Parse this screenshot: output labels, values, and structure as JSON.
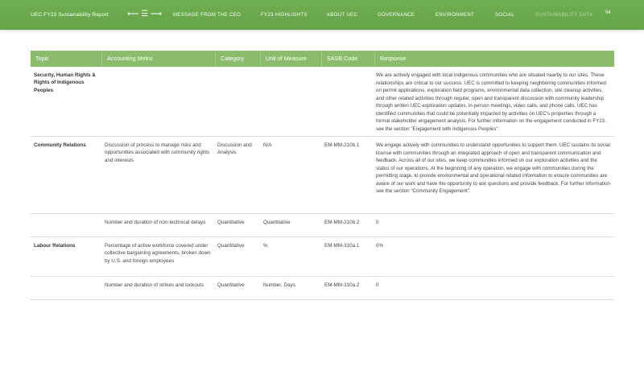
{
  "header": {
    "report_title": "UEC FY23 Sustainability Report",
    "nav_arrows": "⟵ ☰ ⟶",
    "nav": [
      {
        "label": "MESSAGE FROM THE CEO"
      },
      {
        "label": "FY23 HIGHLIGHTS"
      },
      {
        "label": "ABOUT UEC"
      },
      {
        "label": "GOVERNANCE"
      },
      {
        "label": "ENVIRONMENT"
      },
      {
        "label": "SOCIAL"
      },
      {
        "label": "SUSTAINABILITY DATA"
      }
    ],
    "page_number": "94",
    "bar_color": "#6aa84f"
  },
  "table": {
    "header_color": "#8bbc6b",
    "columns": [
      "Topic",
      "Accounting Metric",
      "Category",
      "Unit of Measure",
      "SASB Code",
      "Response"
    ],
    "rows": [
      {
        "topic": "Security, Human Rights & Rights of Indigenous Peoples",
        "metric": "",
        "category": "",
        "unit": "",
        "code": "",
        "response": "We are actively engaged with local indigenous communities who are situated nearby to our sites. These relationships are critical to our success. UEC is committed to keeping neighboring communities informed on permit applications, exploration field programs, environmental data collection, site cleanup activities, and other related activities through regular, open and transparent discussion with community leadership through written UEC exploration updates, in-person meetings, video calls, and phone calls. UEC has identified communities that could be potentially impacted by activities on UEC's properties through a formal stakeholder engagement analysis. For further information on the engagement conducted in FY23, see the section \"Engagement with Indigenous Peoples\"."
      },
      {
        "topic": "Community Relations",
        "metric": "Discussion of process to manage risks and opportunities associated with community rights and interests",
        "category": "Discussion and Analysis",
        "unit": "N/A",
        "code": "EM-MM-210b.1",
        "response": "We engage actively with communities to understand opportunities to support them. UEC sustains its social license with communities through an integrated approach of open and transparent communication and feedback. Across all of our sites, we keep communities informed on our exploration activities and the status of our operations. At the beginning of any operation, we engage with communities during the permitting stage, to provide environmental and operational related information to ensure communities are aware of our work and have the opportunity to ask questions and provide feedback. For further information see the section \"Community Engagement\"."
      },
      {
        "topic": "",
        "metric": "Number and duration of non-technical delays",
        "category": "Quantitative",
        "unit": "Quantitative",
        "code": "EM-MM-210b.2",
        "response": "0"
      },
      {
        "topic": "Labour Relations",
        "metric": "Percentage of active workforce covered under collective bargaining agreements, broken down by U.S. and foreign employees",
        "category": "Quantitative",
        "unit": "%",
        "code": "EM-MM-310a.1",
        "response": "0%"
      },
      {
        "topic": "",
        "metric": "Number and duration of strikes and lockouts",
        "category": "Quantitative",
        "unit": "Number, Days",
        "code": "EM-MM-310a.2",
        "response": "0"
      }
    ]
  }
}
